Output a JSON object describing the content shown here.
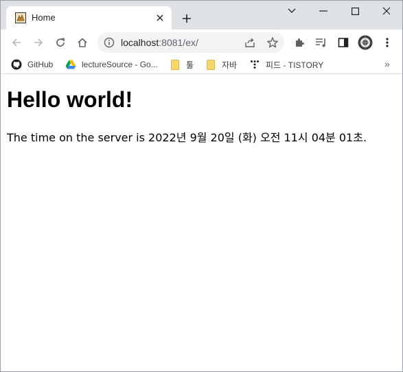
{
  "tab": {
    "title": "Home",
    "favicon": "tomcat-favicon-icon"
  },
  "window_controls": [
    "chevron-down-icon",
    "minimize-icon",
    "maximize-icon",
    "close-window-icon"
  ],
  "toolbar": {
    "url_host": "localhost",
    "url_rest": ":8081/ex/"
  },
  "bookmarks": [
    {
      "label": "GitHub",
      "icon": "github-icon"
    },
    {
      "label": "lectureSource - Go...",
      "icon": "google-drive-icon"
    },
    {
      "label": "툴",
      "icon": "folder-icon"
    },
    {
      "label": "자바",
      "icon": "folder-icon"
    },
    {
      "label": "피드 - TISTORY",
      "icon": "tistory-icon"
    }
  ],
  "bookmarks_more": "»",
  "page": {
    "heading": "Hello world!",
    "server_time": "The time on the server is 2022년 9월 20일 (화) 오전 11시 04분 01초."
  },
  "colors": {
    "tabstrip": "#dee1e6",
    "omnibox": "#f1f3f4",
    "icon": "#5f6368",
    "folder": "#f9d66b"
  }
}
